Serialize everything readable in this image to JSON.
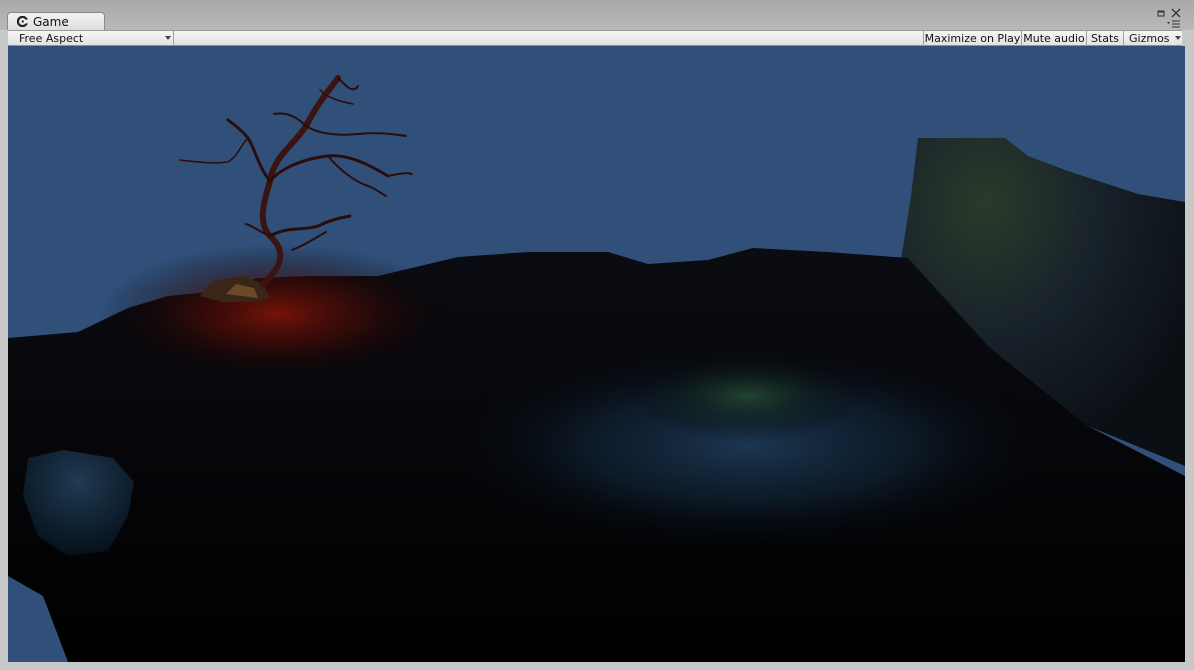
{
  "window": {
    "tab_label": "Game",
    "tab_icon": "game-controller-icon"
  },
  "toolbar": {
    "aspect": "Free Aspect",
    "maximize_on_play": "Maximize on Play",
    "mute_audio": "Mute audio",
    "stats": "Stats",
    "gizmos": "Gizmos"
  },
  "scene": {
    "sky_color": "#30507a"
  }
}
